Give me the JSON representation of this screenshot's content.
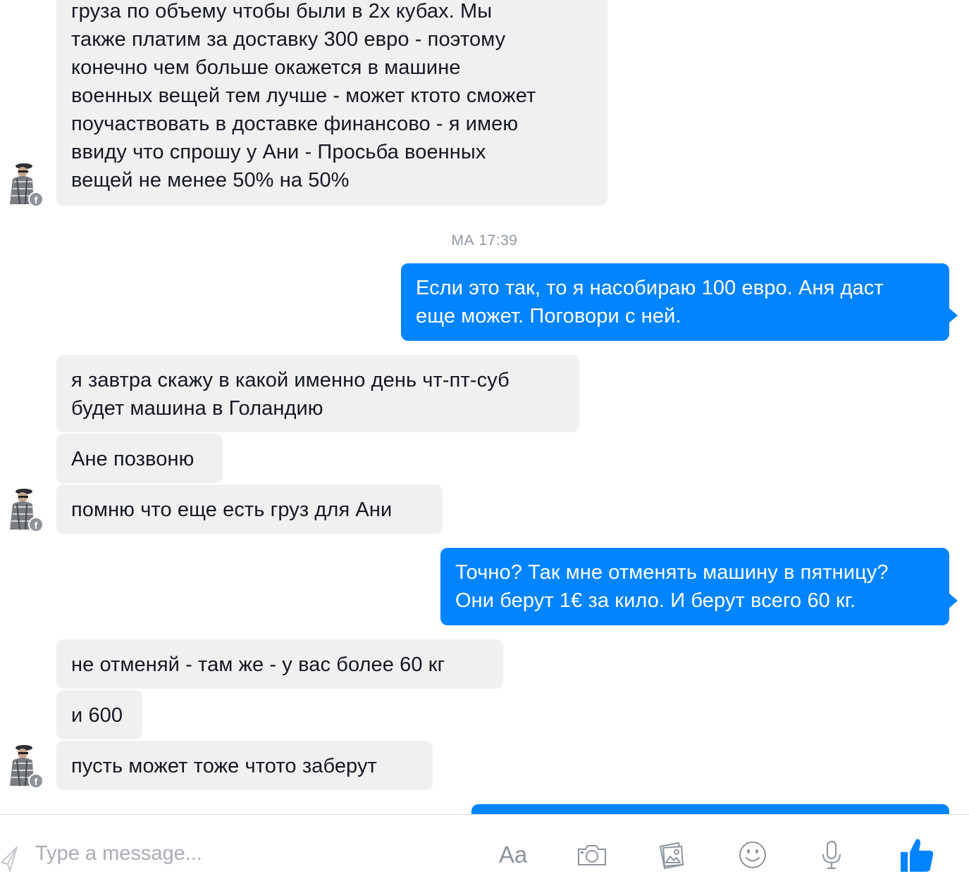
{
  "conversation": {
    "messages": [
      {
        "direction": "incoming",
        "lines": [
          "груза по объему чтобы были в 2х кубах. Мы",
          "также платим за доставку 300 евро - поэтому",
          "конечно чем больше окажется в машине",
          "военных вещей тем лучше - может ктото сможет",
          "поучаствовать в доставке финансово - я имею",
          "ввиду что спрошу у Ани - Просьба военных",
          "вещей не менее 50% на 50%"
        ]
      },
      {
        "timestamp": "МА 17:39"
      },
      {
        "direction": "outgoing",
        "lines": [
          "Если это так, то я насобираю 100 евро. Аня даст",
          "еще может. Поговори с ней."
        ]
      },
      {
        "direction": "incoming",
        "lines": [
          "я завтра скажу в какой именно день чт-пт-суб",
          "будет машина в Голандию"
        ]
      },
      {
        "direction": "incoming",
        "lines": [
          "Ане позвоню"
        ]
      },
      {
        "direction": "incoming",
        "lines": [
          "помню что еще есть груз для Ани"
        ]
      },
      {
        "direction": "outgoing",
        "lines": [
          "Точно? Так мне отменять машину в пятницу?",
          "Они берут 1€ за кило. И берут всего 60 кг."
        ]
      },
      {
        "direction": "incoming",
        "lines": [
          "не отменяй - там же - у вас более 60 кг"
        ]
      },
      {
        "direction": "incoming",
        "lines": [
          "и 600"
        ]
      },
      {
        "direction": "incoming",
        "lines": [
          "пусть может тоже чтото заберут"
        ]
      }
    ]
  },
  "composer": {
    "placeholder": "Type a message...",
    "text_format_label": "Aa",
    "icons": [
      "send-icon",
      "camera-icon",
      "gallery-icon",
      "emoji-icon",
      "microphone-icon",
      "like-icon"
    ]
  },
  "colors": {
    "outgoing_bubble": "#0084ff",
    "incoming_bubble": "#f1f0f0",
    "like_icon": "#0084ff",
    "toolbar_icon": "#8d949e"
  }
}
